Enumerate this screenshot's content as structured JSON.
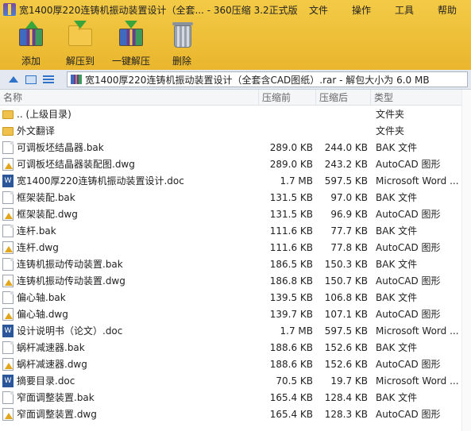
{
  "window": {
    "title": "宽1400厚220连铸机振动装置设计（全套... - 360压缩 3.2正式版"
  },
  "menu": [
    "文件",
    "操作",
    "工具",
    "帮助"
  ],
  "toolbar": [
    {
      "label": "添加",
      "icon": "add-archive-icon"
    },
    {
      "label": "解压到",
      "icon": "extract-to-icon"
    },
    {
      "label": "一键解压",
      "icon": "one-click-extract-icon"
    },
    {
      "label": "删除",
      "icon": "trash-bin-icon"
    }
  ],
  "address": {
    "path": "宽1400厚220连铸机振动装置设计（全套含CAD图纸）.rar - 解包大小为 6.0 MB"
  },
  "columns": {
    "name": "名称",
    "before": "压缩前",
    "after": "压缩后",
    "type": "类型"
  },
  "files": [
    {
      "name": ".. (上级目录)",
      "before": "",
      "after": "",
      "type": "文件夹",
      "icon": "folder"
    },
    {
      "name": "外文翻译",
      "before": "",
      "after": "",
      "type": "文件夹",
      "icon": "folder"
    },
    {
      "name": "可调板坯结晶器.bak",
      "before": "289.0 KB",
      "after": "244.0 KB",
      "type": "BAK 文件",
      "icon": "bak"
    },
    {
      "name": "可调板坯结晶器装配图.dwg",
      "before": "289.0 KB",
      "after": "243.2 KB",
      "type": "AutoCAD 图形",
      "icon": "dwg"
    },
    {
      "name": "宽1400厚220连铸机振动装置设计.doc",
      "before": "1.7 MB",
      "after": "597.5 KB",
      "type": "Microsoft Word ...",
      "icon": "doc"
    },
    {
      "name": "框架装配.bak",
      "before": "131.5 KB",
      "after": "97.0 KB",
      "type": "BAK 文件",
      "icon": "bak"
    },
    {
      "name": "框架装配.dwg",
      "before": "131.5 KB",
      "after": "96.9 KB",
      "type": "AutoCAD 图形",
      "icon": "dwg"
    },
    {
      "name": "连杆.bak",
      "before": "111.6 KB",
      "after": "77.7 KB",
      "type": "BAK 文件",
      "icon": "bak"
    },
    {
      "name": "连杆.dwg",
      "before": "111.6 KB",
      "after": "77.8 KB",
      "type": "AutoCAD 图形",
      "icon": "dwg"
    },
    {
      "name": "连铸机振动传动装置.bak",
      "before": "186.5 KB",
      "after": "150.3 KB",
      "type": "BAK 文件",
      "icon": "bak"
    },
    {
      "name": "连铸机振动传动装置.dwg",
      "before": "186.8 KB",
      "after": "150.7 KB",
      "type": "AutoCAD 图形",
      "icon": "dwg"
    },
    {
      "name": "偏心轴.bak",
      "before": "139.5 KB",
      "after": "106.8 KB",
      "type": "BAK 文件",
      "icon": "bak"
    },
    {
      "name": "偏心轴.dwg",
      "before": "139.7 KB",
      "after": "107.1 KB",
      "type": "AutoCAD 图形",
      "icon": "dwg"
    },
    {
      "name": "设计说明书（论文）.doc",
      "before": "1.7 MB",
      "after": "597.5 KB",
      "type": "Microsoft Word ...",
      "icon": "doc"
    },
    {
      "name": "蜗杆减速器.bak",
      "before": "188.6 KB",
      "after": "152.6 KB",
      "type": "BAK 文件",
      "icon": "bak"
    },
    {
      "name": "蜗杆减速器.dwg",
      "before": "188.6 KB",
      "after": "152.6 KB",
      "type": "AutoCAD 图形",
      "icon": "dwg"
    },
    {
      "name": "摘要目录.doc",
      "before": "70.5 KB",
      "after": "19.7 KB",
      "type": "Microsoft Word ...",
      "icon": "doc"
    },
    {
      "name": "窄面调整装置.bak",
      "before": "165.4 KB",
      "after": "128.4 KB",
      "type": "BAK 文件",
      "icon": "bak"
    },
    {
      "name": "窄面调整装置.dwg",
      "before": "165.4 KB",
      "after": "128.3 KB",
      "type": "AutoCAD 图形",
      "icon": "dwg"
    }
  ]
}
